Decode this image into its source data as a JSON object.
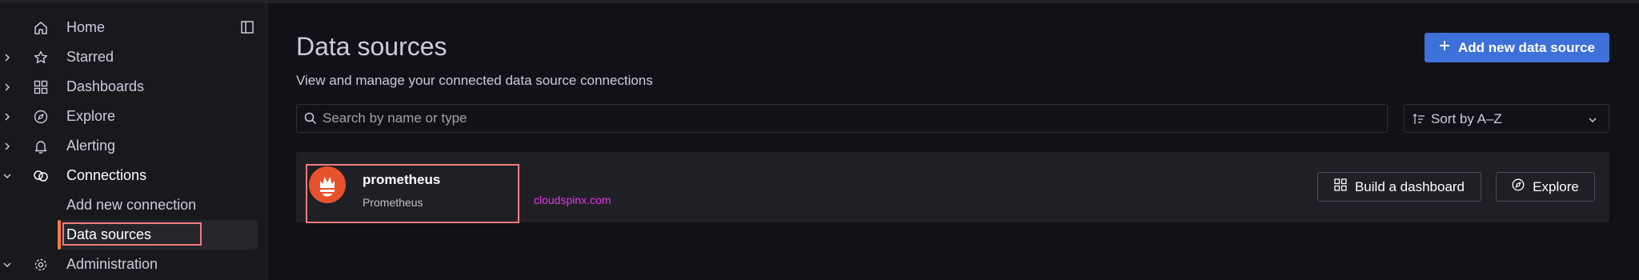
{
  "sidebar": {
    "items": [
      {
        "label": "Home"
      },
      {
        "label": "Starred"
      },
      {
        "label": "Dashboards"
      },
      {
        "label": "Explore"
      },
      {
        "label": "Alerting"
      },
      {
        "label": "Connections"
      },
      {
        "label": "Administration"
      }
    ],
    "sub_items": [
      {
        "label": "Add new connection"
      },
      {
        "label": "Data sources"
      }
    ]
  },
  "header": {
    "title": "Data sources",
    "subtitle": "View and manage your connected data source connections",
    "add_button": "Add new data source"
  },
  "search": {
    "placeholder": "Search by name or type",
    "value": ""
  },
  "sort": {
    "label": "Sort by A–Z"
  },
  "datasources": [
    {
      "name": "prometheus",
      "type": "Prometheus",
      "build_button": "Build a dashboard",
      "explore_button": "Explore"
    }
  ],
  "watermark": "cloudspinx.com",
  "colors": {
    "accent": "#3d71d9",
    "active_marker": "#ff7a3d",
    "prometheus": "#e6522c",
    "annotation": "#f07b7b",
    "watermark": "#e838e8"
  }
}
